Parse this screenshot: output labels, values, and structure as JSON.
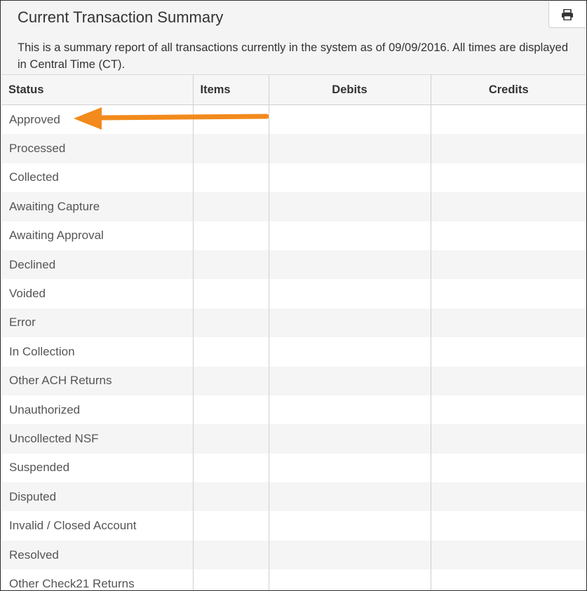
{
  "panel": {
    "title": "Current Transaction Summary",
    "description": "This is a summary report of all transactions currently in the system as of 09/09/2016. All times are displayed in Central Time (CT).",
    "print_icon": "printer-icon"
  },
  "table": {
    "headers": {
      "status": "Status",
      "items": "Items",
      "debits": "Debits",
      "credits": "Credits"
    },
    "rows": [
      "Approved",
      "Processed",
      "Collected",
      "Awaiting Capture",
      "Awaiting Approval",
      "Declined",
      "Voided",
      "Error",
      "In Collection",
      "Other ACH Returns",
      "Unauthorized",
      "Uncollected NSF",
      "Suspended",
      "Disputed",
      "Invalid / Closed Account",
      "Resolved",
      "Other Check21 Returns"
    ]
  },
  "annotation": {
    "arrow_color": "#f28a1c",
    "arrow_icon": "left-arrow-annotation"
  }
}
